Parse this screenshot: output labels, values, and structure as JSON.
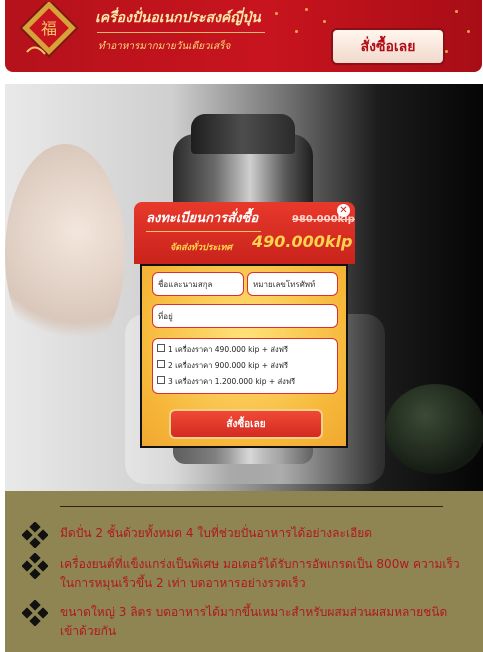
{
  "banner": {
    "title": "เครื่องปั่นอเนกประสงค์ญี่ปุ่น",
    "subtitle": "ทำอาหารมากมายวันเดียวเสร็จ",
    "cta_label": "สั่งซื้อเลย"
  },
  "photo": {
    "icon": "product-photo"
  },
  "order_form": {
    "title": "ลงทะเบียนการสั่งซื้อ",
    "old_price": "980.000kip",
    "shipping": "จัดส่งทั่วประเทศ",
    "price": "490.000klp",
    "name_placeholder": "ชื่อและนามสกุล",
    "phone_placeholder": "หมายเลขโทรศัพท์",
    "address_placeholder": "ที่อยู่",
    "options": [
      {
        "label": "1 เครื่องราคา 490.000 kip + ส่งฟรี"
      },
      {
        "label": "2 เครื่องราคา 900.000 kip + ส่งฟรี"
      },
      {
        "label": "3 เครื่องราคา 1.200.000 kip + ส่งฟรี"
      }
    ],
    "submit_label": "สั่งซื้อเลย"
  },
  "features": [
    {
      "text": "มีดปั่น 2 ชั้นด้วยทั้งหมด 4 ใบที่ช่วยปั่นอาหารได้อย่างละเอียด"
    },
    {
      "text": "เครื่องยนต์ที่แข็งแกร่งเป็นพิเศษ มอเตอร์ได้รับการอัพเกรดเป็น 800w ความเร็วในการหมุนเร็วขึ้น 2 เท่า บดอาหารอย่างรวดเร็ว"
    },
    {
      "text": "ขนาดใหญ่ 3 ลิตร บดอาหารได้มากขึ้นเหมาะสำหรับผสมส่วนผสมหลายชนิดเข้าด้วยกัน"
    }
  ],
  "colors": {
    "brand_red": "#c8141e",
    "accent_gold": "#ffd34d",
    "feature_bg": "#8f8552"
  }
}
